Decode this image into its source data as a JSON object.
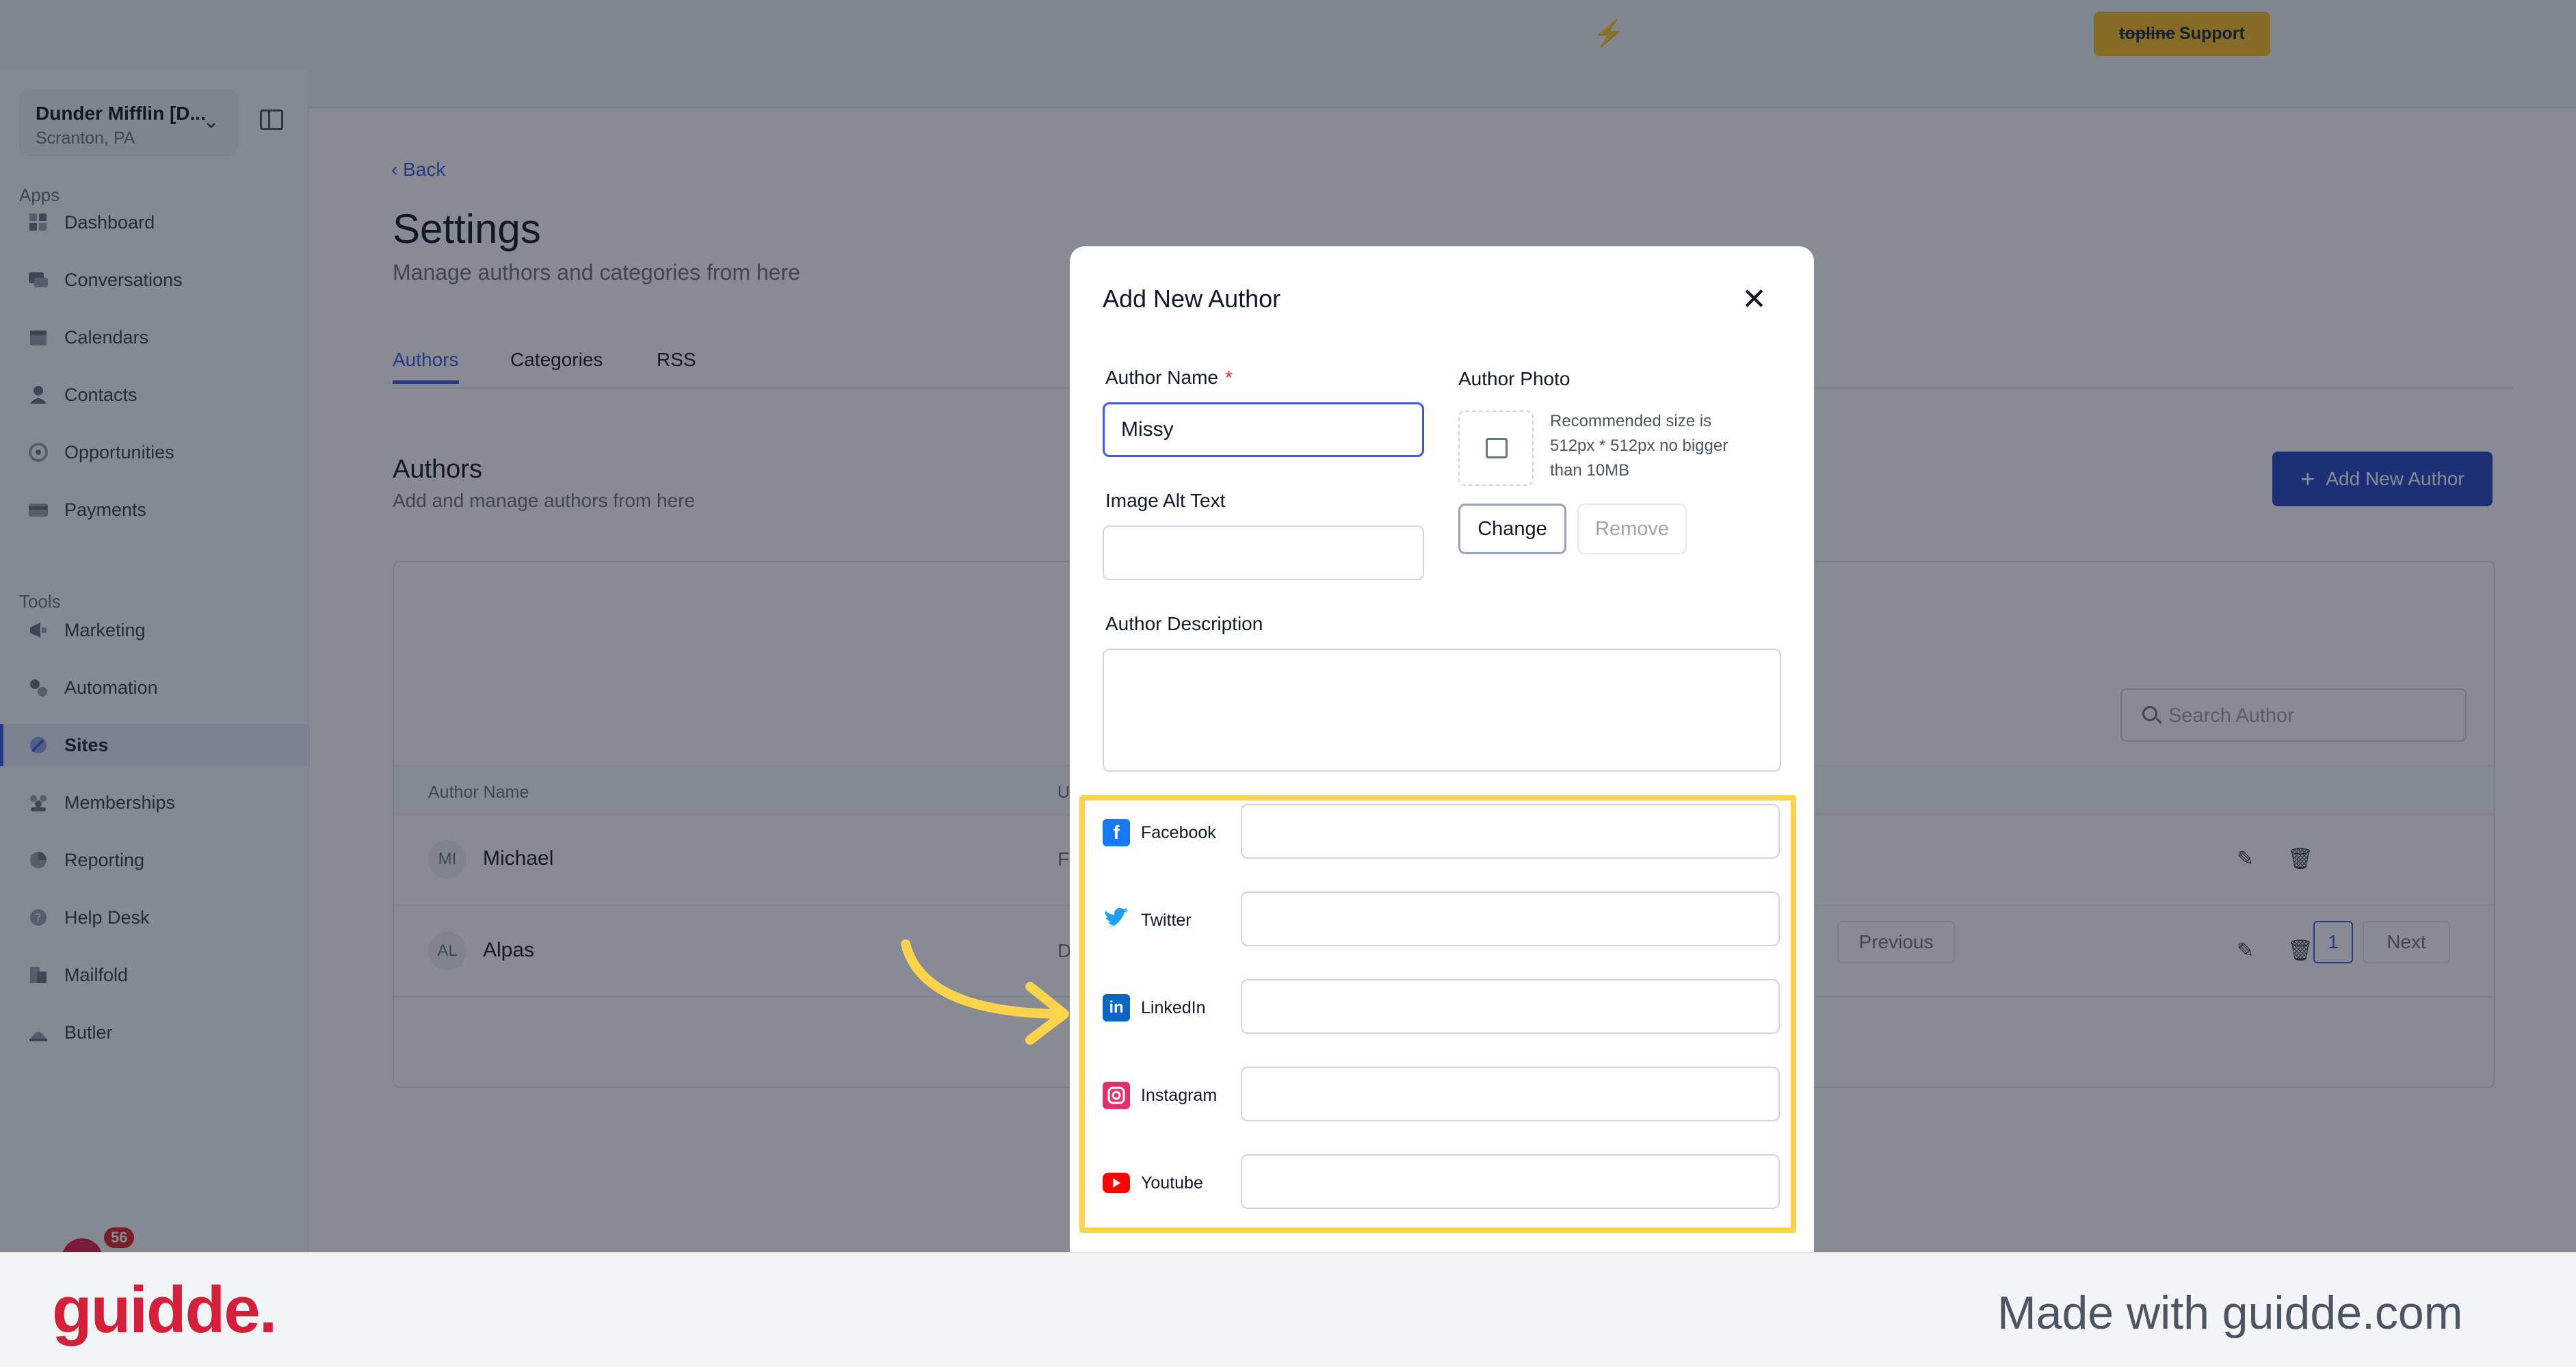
{
  "topbar": {
    "support_label_strike": "topline",
    "support_label": "Support"
  },
  "sidebar": {
    "account_name": "Dunder Mifflin [D...",
    "account_location": "Scranton, PA",
    "apps_label": "Apps",
    "tools_label": "Tools",
    "apps": [
      {
        "label": "Dashboard",
        "icon": "dashboard-icon"
      },
      {
        "label": "Conversations",
        "icon": "chat-icon"
      },
      {
        "label": "Calendars",
        "icon": "calendar-icon"
      },
      {
        "label": "Contacts",
        "icon": "contact-icon"
      },
      {
        "label": "Opportunities",
        "icon": "opportunities-icon"
      },
      {
        "label": "Payments",
        "icon": "payment-icon"
      }
    ],
    "tools": [
      {
        "label": "Marketing",
        "icon": "megaphone-icon"
      },
      {
        "label": "Automation",
        "icon": "gear-icon"
      },
      {
        "label": "Sites",
        "icon": "globe-icon"
      },
      {
        "label": "Memberships",
        "icon": "members-icon"
      },
      {
        "label": "Reporting",
        "icon": "chart-icon"
      },
      {
        "label": "Help Desk",
        "icon": "help-icon"
      },
      {
        "label": "Mailfold",
        "icon": "mail-icon"
      },
      {
        "label": "Butler",
        "icon": "butler-icon"
      }
    ],
    "notification_count": "56"
  },
  "page": {
    "back_label": "Back",
    "title": "Settings",
    "subtitle": "Manage authors and categories from here",
    "tabs": [
      {
        "label": "Authors"
      },
      {
        "label": "Categories"
      },
      {
        "label": "RSS"
      }
    ],
    "authors_heading": "Authors",
    "authors_sub": "Add and manage authors from here",
    "add_author_label": "Add New Author",
    "search_placeholder": "Search Author",
    "table": {
      "col_author_name": "Author Name",
      "col_second": "U",
      "rows": [
        {
          "initials": "MI",
          "name": "Michael",
          "second": "Fe"
        },
        {
          "initials": "AL",
          "name": "Alpas",
          "second": "D"
        }
      ]
    },
    "pagination": {
      "previous": "Previous",
      "current": "1",
      "next": "Next"
    }
  },
  "modal": {
    "title": "Add New Author",
    "author_name_label": "Author Name",
    "required_mark": "*",
    "author_name_value": "Missy",
    "author_photo_label": "Author Photo",
    "photo_recommendation": "Recommended size is 512px * 512px no bigger than 10MB",
    "change_label": "Change",
    "remove_label": "Remove",
    "image_alt_label": "Image Alt Text",
    "description_label": "Author Description",
    "social": [
      {
        "label": "Facebook",
        "icon": "facebook-icon",
        "color": "#1877f2"
      },
      {
        "label": "Twitter",
        "icon": "twitter-icon",
        "color": "#1da1f2"
      },
      {
        "label": "LinkedIn",
        "icon": "linkedin-icon",
        "color": "#0a66c2"
      },
      {
        "label": "Instagram",
        "icon": "instagram-icon",
        "color": "#e1306c"
      },
      {
        "label": "Youtube",
        "icon": "youtube-icon",
        "color": "#ff0000"
      }
    ]
  },
  "footer": {
    "logo": "guidde.",
    "made_with": "Made with guidde.com"
  },
  "colors": {
    "accent": "#3b5bdb",
    "highlight": "#fcd34d",
    "brand_red": "#d41f3a"
  }
}
